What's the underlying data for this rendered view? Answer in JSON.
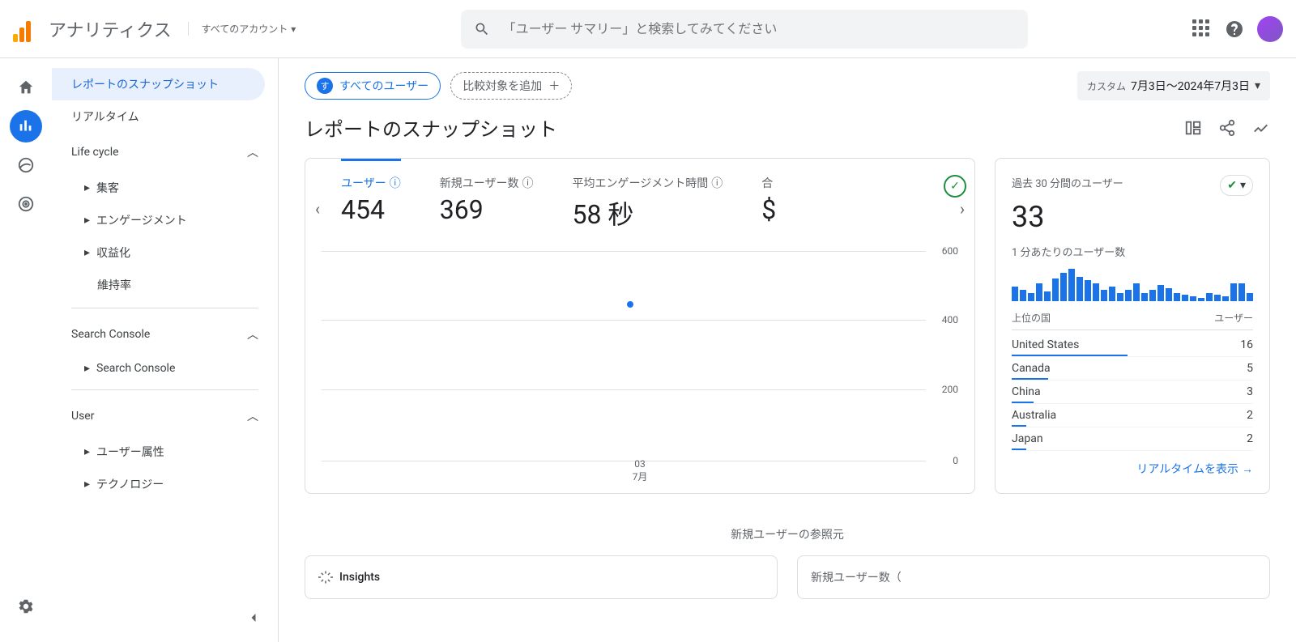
{
  "header": {
    "app_title": "アナリティクス",
    "account_label": "すべてのアカウント",
    "search_placeholder": "「ユーザー サマリー」と検索してみてください"
  },
  "sidebar": {
    "items": [
      "レポートのスナップショット",
      "リアルタイム"
    ],
    "sections": [
      {
        "title": "Life cycle",
        "children": [
          "集客",
          "エンゲージメント",
          "収益化",
          "維持率"
        ]
      },
      {
        "title": "Search Console",
        "children": [
          "Search Console"
        ]
      },
      {
        "title": "User",
        "children": [
          "ユーザー属性",
          "テクノロジー"
        ]
      }
    ]
  },
  "filters": {
    "all_users_badge": "す",
    "all_users": "すべてのユーザー",
    "add_compare": "比較対象を追加",
    "date_custom": "カスタム",
    "date_value": "7月3日～2024年7月3日"
  },
  "page_title": "レポートのスナップショット",
  "metrics": [
    {
      "label": "ユーザー",
      "value": "454"
    },
    {
      "label": "新規ユーザー数",
      "value": "369"
    },
    {
      "label": "平均エンゲージメント時間",
      "value": "58 秒"
    },
    {
      "label_short": "合",
      "value": "$"
    }
  ],
  "chart": {
    "y_ticks": [
      "600",
      "400",
      "200",
      "0"
    ],
    "x_tick": "03",
    "x_month": "7月"
  },
  "realtime": {
    "title": "過去 30 分間のユーザー",
    "big": "33",
    "sub": "1 分あたりのユーザー数",
    "bars": [
      18,
      14,
      10,
      22,
      12,
      28,
      35,
      40,
      30,
      26,
      22,
      14,
      18,
      10,
      14,
      22,
      10,
      14,
      20,
      16,
      10,
      8,
      6,
      4,
      10,
      8,
      6,
      22,
      22,
      10
    ],
    "col_country": "上位の国",
    "col_users": "ユーザー",
    "rows": [
      {
        "country": "United States",
        "users": "16",
        "pct": 48
      },
      {
        "country": "Canada",
        "users": "5",
        "pct": 15
      },
      {
        "country": "China",
        "users": "3",
        "pct": 9
      },
      {
        "country": "Australia",
        "users": "2",
        "pct": 6
      },
      {
        "country": "Japan",
        "users": "2",
        "pct": 6
      }
    ],
    "link": "リアルタイムを表示"
  },
  "lower": {
    "section_label": "新規ユーザーの参照元",
    "insights_label": "Insights",
    "new_users_prefix": "新規ユーザー数（"
  }
}
